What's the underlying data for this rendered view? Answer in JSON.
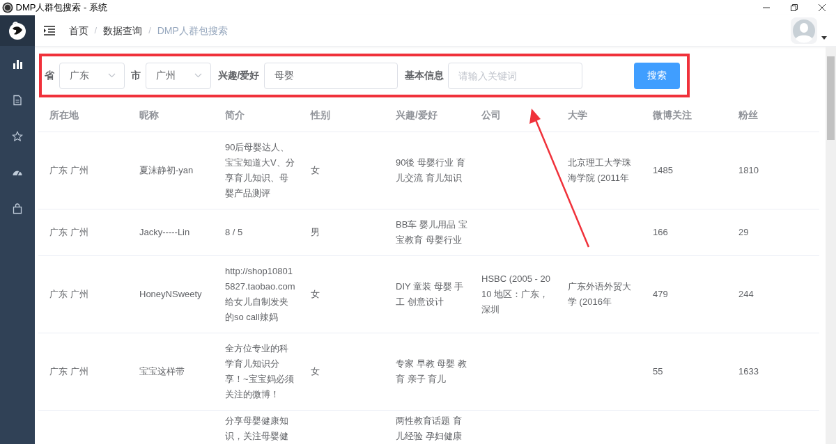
{
  "window": {
    "title": "DMP人群包搜索 - 系统"
  },
  "breadcrumb": {
    "separator": "/",
    "items": [
      {
        "label": "首页",
        "current": false
      },
      {
        "label": "数据查询",
        "current": false
      },
      {
        "label": "DMP人群包搜索",
        "current": true
      }
    ]
  },
  "filters": [
    {
      "kind": "select",
      "label": "省",
      "value": "广东"
    },
    {
      "kind": "select",
      "label": "市",
      "value": "广州"
    },
    {
      "kind": "text",
      "label": "兴趣/爱好",
      "value": "母婴"
    },
    {
      "kind": "text",
      "label": "基本信息",
      "placeholder": "请输入关键词"
    }
  ],
  "search_button": "搜索",
  "table": {
    "columns": [
      "所在地",
      "昵称",
      "简介",
      "性别",
      "兴趣/爱好",
      "公司",
      "大学",
      "微博关注",
      "粉丝"
    ],
    "rows": [
      [
        [
          "广东 广州"
        ],
        [
          "夏沫静初-yan"
        ],
        [
          "90后母婴达人、",
          "宝宝知道大V、分",
          "享育儿知识、母",
          "婴产品测评"
        ],
        [
          "女"
        ],
        [
          "90後 母婴行业 育",
          "儿交流 育儿知识"
        ],
        [],
        [
          "北京理工大学珠",
          "海学院 (2011年"
        ],
        [
          "1485"
        ],
        [
          "1810"
        ]
      ],
      [
        [
          "广东 广州"
        ],
        [
          "Jacky-----Lin"
        ],
        [
          "8 / 5"
        ],
        [
          "男"
        ],
        [
          "BB车 婴儿用品 宝",
          "宝教育 母婴行业"
        ],
        [],
        [],
        [
          "166"
        ],
        [
          "29"
        ]
      ],
      [
        [
          "广东 广州"
        ],
        [
          "HoneyNSweety"
        ],
        [
          "http://shop10801",
          "5827.taobao.com",
          "给女儿自制发夹",
          "的so call辣妈"
        ],
        [
          "女"
        ],
        [
          "DIY 童装 母婴 手",
          "工 创意设计"
        ],
        [
          "HSBC (2005 - 20",
          "10 地区：广东，",
          "深圳"
        ],
        [
          "广东外语外贸大",
          "学 (2016年"
        ],
        [
          "479"
        ],
        [
          "244"
        ]
      ],
      [
        [
          "广东 广州"
        ],
        [
          "宝宝这样带"
        ],
        [
          "全方位专业的科",
          "学育儿知识分",
          "享！~宝宝妈必须",
          "关注的微博！"
        ],
        [
          "女"
        ],
        [
          "专家 早教 母婴 教",
          "育 亲子 育儿"
        ],
        [],
        [],
        [
          "55"
        ],
        [
          "1633"
        ]
      ],
      [
        [],
        [],
        [
          "分享母婴健康知",
          "识，关注母婴健"
        ],
        [],
        [
          "两性教育话题 育",
          "儿经验 孕妇健康"
        ],
        [],
        [],
        [],
        []
      ]
    ]
  }
}
